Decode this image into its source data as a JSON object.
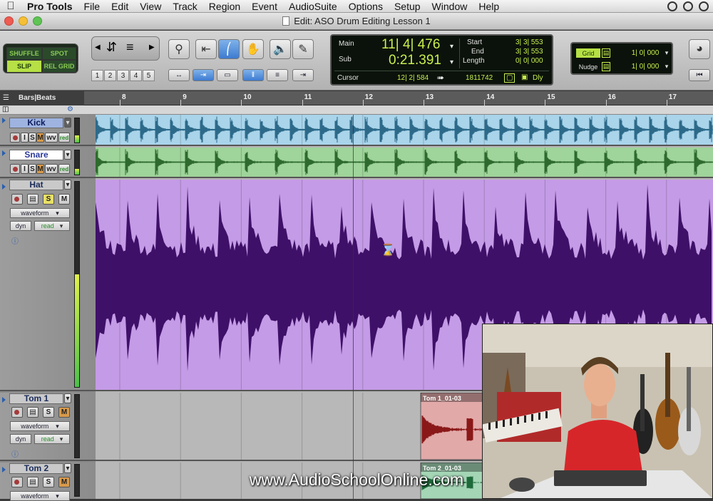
{
  "menubar": {
    "app": "Pro Tools",
    "items": [
      "File",
      "Edit",
      "View",
      "Track",
      "Region",
      "Event",
      "AudioSuite",
      "Options",
      "Setup",
      "Window",
      "Help"
    ]
  },
  "window": {
    "title": "Edit: ASO Drum Editing Lesson 1"
  },
  "edit_modes": {
    "shuffle": "SHUFFLE",
    "spot": "SPOT",
    "slip": "SLIP",
    "relgrid": "REL GRID"
  },
  "zoom_presets": [
    "1",
    "2",
    "3",
    "4",
    "5"
  ],
  "counter": {
    "main_label": "Main",
    "main_value": "11| 4| 476",
    "sub_label": "Sub",
    "sub_value": "0:21.391",
    "start_label": "Start",
    "start_value": "3| 3| 553",
    "end_label": "End",
    "end_value": "3| 3| 553",
    "length_label": "Length",
    "length_value": "0| 0| 000",
    "cursor_label": "Cursor",
    "cursor_value": "12| 2| 584",
    "cursor_samples": "1811742",
    "dly_label": "Dly"
  },
  "grid": {
    "grid_label": "Grid",
    "grid_value": "1| 0| 000",
    "nudge_label": "Nudge",
    "nudge_value": "1| 0| 000"
  },
  "ruler": {
    "label": "Bars|Beats",
    "bars": [
      "8",
      "9",
      "10",
      "11",
      "12",
      "13",
      "14",
      "15",
      "16",
      "17"
    ]
  },
  "tracks": [
    {
      "name": "Kick",
      "buttons": {
        "i": "I",
        "s": "S",
        "m": "M",
        "wv": "wv",
        "rd": "red"
      },
      "color": "#a9d4ea",
      "wave": "#2d6a8a"
    },
    {
      "name": "Snare",
      "buttons": {
        "i": "I",
        "s": "S",
        "m": "M",
        "wv": "wv",
        "rd": "red"
      },
      "color": "#9fd49a",
      "wave": "#2e6a2e"
    },
    {
      "name": "Hat",
      "buttons": {
        "s": "S",
        "m": "M"
      },
      "view": "waveform",
      "auto_dyn": "dyn",
      "auto_mode": "read",
      "color": "#c49be6",
      "wave": "#3f1068"
    },
    {
      "name": "Tom 1",
      "buttons": {
        "s": "S",
        "m": "M"
      },
      "view": "waveform",
      "auto_dyn": "dyn",
      "auto_mode": "read",
      "clip": "Tom 1_01-03",
      "clip_color": "#e2a9a9",
      "wave": "#8a1818"
    },
    {
      "name": "Tom 2",
      "buttons": {
        "s": "S",
        "m": "M"
      },
      "view": "waveform",
      "clip": "Tom 2_01-03",
      "clip_color": "#a4d6b6",
      "wave": "#1e6a3a"
    }
  ],
  "watermark": "www.AudioSchoolOnline.com"
}
